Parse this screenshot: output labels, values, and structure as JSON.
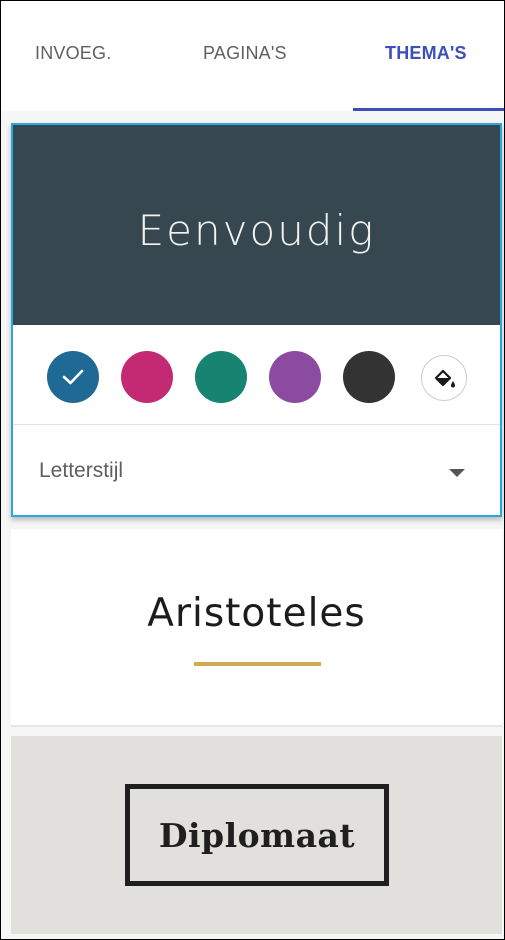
{
  "tabs": {
    "items": [
      {
        "label": "INVOEG."
      },
      {
        "label": "PAGINA'S"
      },
      {
        "label": "THEMA'S"
      }
    ],
    "active_index": 2,
    "active_color": "#3d4fb8"
  },
  "selected_theme": {
    "title": "Eenvoudig",
    "preview_color": "#37474f",
    "border_color": "#29a8e0",
    "colors": [
      {
        "name": "blue",
        "hex": "#1f6a94",
        "selected": true
      },
      {
        "name": "magenta",
        "hex": "#c42a74",
        "selected": false
      },
      {
        "name": "teal",
        "hex": "#178471",
        "selected": false
      },
      {
        "name": "purple",
        "hex": "#8b4ba0",
        "selected": false
      },
      {
        "name": "dark-gray",
        "hex": "#333333",
        "selected": false
      }
    ],
    "selected_icon": "check-icon",
    "custom_color_icon": "paint-bucket-icon",
    "font_style": {
      "label": "Letterstijl",
      "icon": "dropdown-arrow-icon"
    }
  },
  "themes": [
    {
      "name": "Aristoteles",
      "accent_color": "#d4a853"
    },
    {
      "name": "Diplomaat",
      "background_color": "#e2e0dc"
    }
  ]
}
